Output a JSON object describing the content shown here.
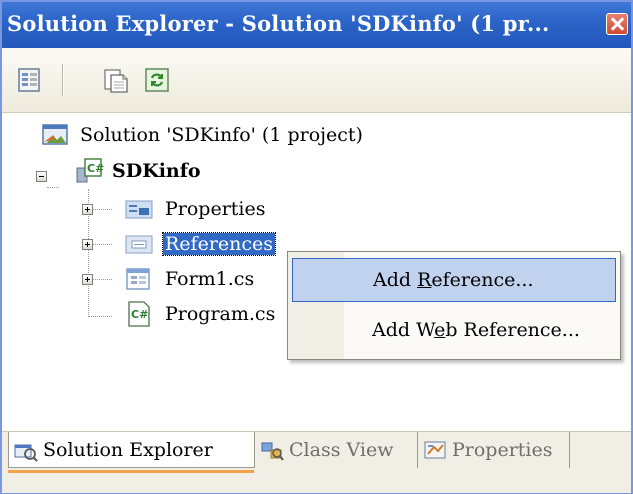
{
  "window": {
    "title": "Solution Explorer - Solution 'SDKinfo' (1 pr...",
    "close_icon": "close-icon"
  },
  "toolbar": {
    "buttons": [
      {
        "icon": "properties-icon"
      },
      {
        "icon": "show-all-files-icon"
      },
      {
        "icon": "refresh-icon"
      }
    ]
  },
  "tree": {
    "solution": "Solution 'SDKinfo' (1 project)",
    "project": "SDKinfo",
    "items": {
      "properties": "Properties",
      "references": "References",
      "form1": "Form1.cs",
      "program": "Program.cs"
    }
  },
  "context_menu": {
    "add_reference_prefix": "Add ",
    "add_reference_accel": "R",
    "add_reference_suffix": "eference...",
    "add_web_reference_prefix": "Add W",
    "add_web_reference_accel": "e",
    "add_web_reference_suffix": "b Reference..."
  },
  "tabs": {
    "solution_explorer": "Solution Explorer",
    "class_view": "Class View",
    "properties": "Properties"
  },
  "colors": {
    "title_bar": "#2b63c6",
    "selection": "#3169c6",
    "menu_hover": "#c1d2ee",
    "active_tab_accent": "#f3a24a"
  }
}
